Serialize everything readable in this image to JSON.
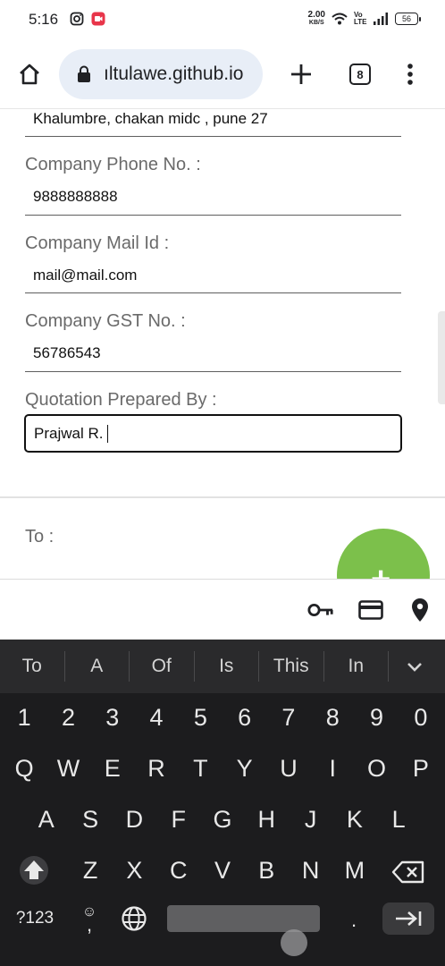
{
  "status_bar": {
    "time": "5:16",
    "net_speed_value": "2.00",
    "net_speed_unit": "KB/S",
    "volte": "Vo LTE",
    "battery": "56"
  },
  "browser": {
    "url": "ıltulawe.github.io",
    "tab_count": "8",
    "icons": [
      "home-icon",
      "lock-icon",
      "new-tab-icon",
      "tab-switcher-icon",
      "menu-icon"
    ]
  },
  "form": {
    "address_value": "Khalumbre, chakan midc , pune 27",
    "phone_label": "Company Phone No. :",
    "phone_value": "9888888888",
    "mail_label": "Company Mail Id :",
    "mail_value": "mail@mail.com",
    "gst_label": "Company GST No. :",
    "gst_value": "56786543",
    "prepared_label": "Quotation Prepared By :",
    "prepared_value": "Prajwal R.",
    "to_label": "To :",
    "fab_symbol": "+",
    "fab_color": "#7cc04b"
  },
  "autofill_bar": {
    "icons": [
      "key-icon",
      "credit-card-icon",
      "location-pin-icon"
    ]
  },
  "keyboard": {
    "suggestions": [
      "To",
      "A",
      "Of",
      "Is",
      "This",
      "In"
    ],
    "number_row": [
      "1",
      "2",
      "3",
      "4",
      "5",
      "6",
      "7",
      "8",
      "9",
      "0"
    ],
    "row1": [
      "Q",
      "W",
      "E",
      "R",
      "T",
      "Y",
      "U",
      "I",
      "O",
      "P"
    ],
    "row2": [
      "A",
      "S",
      "D",
      "F",
      "G",
      "H",
      "J",
      "K",
      "L"
    ],
    "row3": [
      "Z",
      "X",
      "C",
      "V",
      "B",
      "N",
      "M"
    ],
    "symbols_key": "?123",
    "emoji_key": "☺",
    "comma_key": ",",
    "period_key": ".",
    "background_color": "#1c1c1e"
  }
}
